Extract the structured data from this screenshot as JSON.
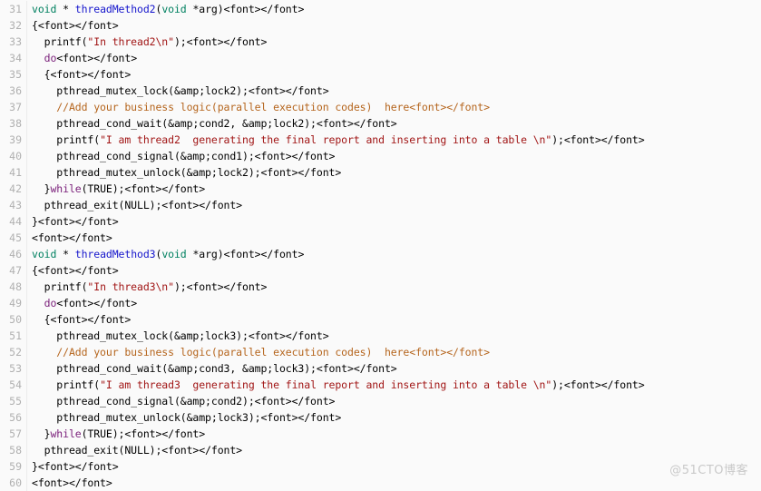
{
  "viewer": {
    "name": "code-block",
    "language": "c",
    "background_color": "#fafafa",
    "gutter_color": "#b0b0b0",
    "first_line": 31,
    "last_line": 60
  },
  "palette": {
    "type": "#008060",
    "function": "#1515cc",
    "string": "#a11616",
    "comment": "#b5651d",
    "keyword": "#7a1f7a",
    "plain": "#000000",
    "line_number": "#b0b0b0",
    "watermark": "#c9c9c9",
    "background": "#fafafa"
  },
  "watermark": {
    "text": "@51CTO博客"
  },
  "lines": [
    {
      "n": "31",
      "tokens": [
        {
          "t": "void",
          "c": "type"
        },
        {
          "t": " * ",
          "c": "plain"
        },
        {
          "t": "threadMethod2",
          "c": "fn"
        },
        {
          "t": "(",
          "c": "plain"
        },
        {
          "t": "void",
          "c": "type"
        },
        {
          "t": " *arg)<font></font>",
          "c": "plain"
        }
      ]
    },
    {
      "n": "32",
      "tokens": [
        {
          "t": "{<font></font>",
          "c": "plain"
        }
      ]
    },
    {
      "n": "33",
      "tokens": [
        {
          "t": "  printf(",
          "c": "plain"
        },
        {
          "t": "\"In thread2\\n\"",
          "c": "string"
        },
        {
          "t": ");<font></font>",
          "c": "plain"
        }
      ]
    },
    {
      "n": "34",
      "tokens": [
        {
          "t": "  ",
          "c": "plain"
        },
        {
          "t": "do",
          "c": "keyword"
        },
        {
          "t": "<font></font>",
          "c": "plain"
        }
      ]
    },
    {
      "n": "35",
      "tokens": [
        {
          "t": "  {<font></font>",
          "c": "plain"
        }
      ]
    },
    {
      "n": "36",
      "tokens": [
        {
          "t": "    pthread_mutex_lock(&amp;lock2);<font></font>",
          "c": "plain"
        }
      ]
    },
    {
      "n": "37",
      "tokens": [
        {
          "t": "    //Add your business logic(parallel execution codes)  here",
          "c": "comment"
        },
        {
          "t": "<font></font>",
          "c": "comment"
        }
      ]
    },
    {
      "n": "38",
      "tokens": [
        {
          "t": "    pthread_cond_wait(&amp;cond2, &amp;lock2);<font></font>",
          "c": "plain"
        }
      ]
    },
    {
      "n": "39",
      "tokens": [
        {
          "t": "    printf(",
          "c": "plain"
        },
        {
          "t": "\"I am thread2  generating the final report and inserting into a table \\n\"",
          "c": "string"
        },
        {
          "t": ");<font></font>",
          "c": "plain"
        }
      ]
    },
    {
      "n": "40",
      "tokens": [
        {
          "t": "    pthread_cond_signal(&amp;cond1);<font></font>",
          "c": "plain"
        }
      ]
    },
    {
      "n": "41",
      "tokens": [
        {
          "t": "    pthread_mutex_unlock(&amp;lock2);<font></font>",
          "c": "plain"
        }
      ]
    },
    {
      "n": "42",
      "tokens": [
        {
          "t": "  }",
          "c": "plain"
        },
        {
          "t": "while",
          "c": "keyword"
        },
        {
          "t": "(TRUE);<font></font>",
          "c": "plain"
        }
      ]
    },
    {
      "n": "43",
      "tokens": [
        {
          "t": "  pthread_exit(NULL);<font></font>",
          "c": "plain"
        }
      ]
    },
    {
      "n": "44",
      "tokens": [
        {
          "t": "}<font></font>",
          "c": "plain"
        }
      ]
    },
    {
      "n": "45",
      "tokens": [
        {
          "t": "<font></font>",
          "c": "plain"
        }
      ]
    },
    {
      "n": "46",
      "tokens": [
        {
          "t": "void",
          "c": "type"
        },
        {
          "t": " * ",
          "c": "plain"
        },
        {
          "t": "threadMethod3",
          "c": "fn"
        },
        {
          "t": "(",
          "c": "plain"
        },
        {
          "t": "void",
          "c": "type"
        },
        {
          "t": " *arg)<font></font>",
          "c": "plain"
        }
      ]
    },
    {
      "n": "47",
      "tokens": [
        {
          "t": "{<font></font>",
          "c": "plain"
        }
      ]
    },
    {
      "n": "48",
      "tokens": [
        {
          "t": "  printf(",
          "c": "plain"
        },
        {
          "t": "\"In thread3\\n\"",
          "c": "string"
        },
        {
          "t": ");<font></font>",
          "c": "plain"
        }
      ]
    },
    {
      "n": "49",
      "tokens": [
        {
          "t": "  ",
          "c": "plain"
        },
        {
          "t": "do",
          "c": "keyword"
        },
        {
          "t": "<font></font>",
          "c": "plain"
        }
      ]
    },
    {
      "n": "50",
      "tokens": [
        {
          "t": "  {<font></font>",
          "c": "plain"
        }
      ]
    },
    {
      "n": "51",
      "tokens": [
        {
          "t": "    pthread_mutex_lock(&amp;lock3);<font></font>",
          "c": "plain"
        }
      ]
    },
    {
      "n": "52",
      "tokens": [
        {
          "t": "    //Add your business logic(parallel execution codes)  here",
          "c": "comment"
        },
        {
          "t": "<font></font>",
          "c": "comment"
        }
      ]
    },
    {
      "n": "53",
      "tokens": [
        {
          "t": "    pthread_cond_wait(&amp;cond3, &amp;lock3);<font></font>",
          "c": "plain"
        }
      ]
    },
    {
      "n": "54",
      "tokens": [
        {
          "t": "    printf(",
          "c": "plain"
        },
        {
          "t": "\"I am thread3  generating the final report and inserting into a table \\n\"",
          "c": "string"
        },
        {
          "t": ");<font></font>",
          "c": "plain"
        }
      ]
    },
    {
      "n": "55",
      "tokens": [
        {
          "t": "    pthread_cond_signal(&amp;cond2);<font></font>",
          "c": "plain"
        }
      ]
    },
    {
      "n": "56",
      "tokens": [
        {
          "t": "    pthread_mutex_unlock(&amp;lock3);<font></font>",
          "c": "plain"
        }
      ]
    },
    {
      "n": "57",
      "tokens": [
        {
          "t": "  }",
          "c": "plain"
        },
        {
          "t": "while",
          "c": "keyword"
        },
        {
          "t": "(TRUE);<font></font>",
          "c": "plain"
        }
      ]
    },
    {
      "n": "58",
      "tokens": [
        {
          "t": "  pthread_exit(NULL);<font></font>",
          "c": "plain"
        }
      ]
    },
    {
      "n": "59",
      "tokens": [
        {
          "t": "}<font></font>",
          "c": "plain"
        }
      ]
    },
    {
      "n": "60",
      "tokens": [
        {
          "t": "<font></font>",
          "c": "plain"
        }
      ]
    }
  ]
}
